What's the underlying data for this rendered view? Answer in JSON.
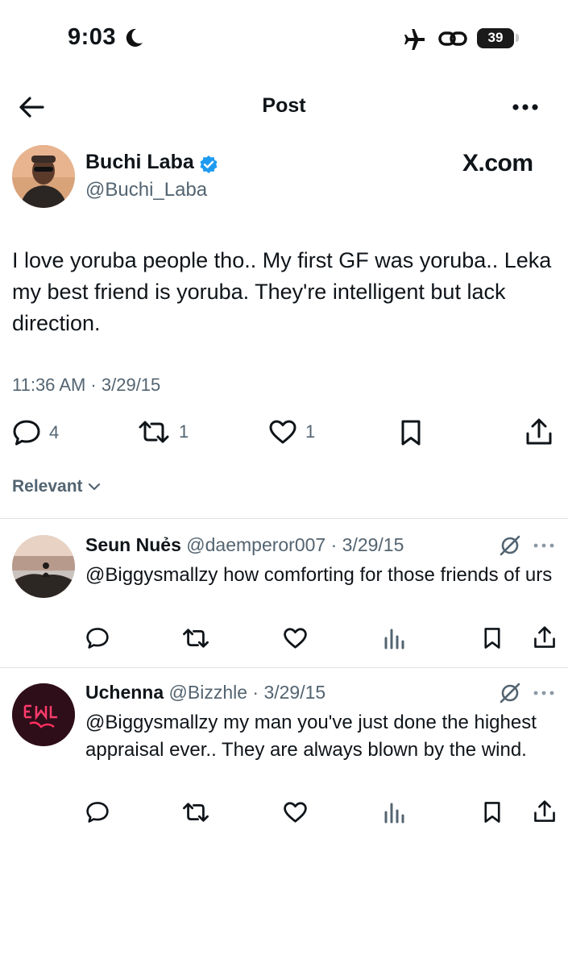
{
  "status_bar": {
    "time": "9:03",
    "battery": "39"
  },
  "header": {
    "title": "Post"
  },
  "post": {
    "author_name": "Buchi Laba",
    "author_handle": "@Buchi_Laba",
    "watermark": "X.com",
    "text": "I love yoruba people tho.. My first GF was yoruba.. Leka my best friend is yoruba. They're intelligent but lack direction.",
    "timestamp": "11:36 AM · 3/29/15",
    "replies": "4",
    "reposts": "1",
    "likes": "1"
  },
  "sort": {
    "label": "Relevant"
  },
  "replies": [
    {
      "name": "Seun Nuẻs",
      "handle": "@daemperor007 · 3/29/15",
      "text": "@Biggysmallzy how comforting for those friends of urs"
    },
    {
      "name": "Uchenna",
      "handle": "@Bizzhle · 3/29/15",
      "text": "@Biggysmallzy my man you've just done the highest appraisal ever.. They are always blown by the wind."
    }
  ],
  "icons": {
    "back": "arrow-left-icon",
    "more": "more-horizontal-icon",
    "verified": "verified-badge-icon",
    "reply": "comment-icon",
    "repost": "repost-icon",
    "like": "heart-icon",
    "views": "views-icon",
    "bookmark": "bookmark-icon",
    "share": "share-icon",
    "grok": "grok-icon"
  },
  "colors": {
    "verified": "#1d9bf0",
    "secondary_text": "#536471",
    "text": "#0f1419"
  }
}
